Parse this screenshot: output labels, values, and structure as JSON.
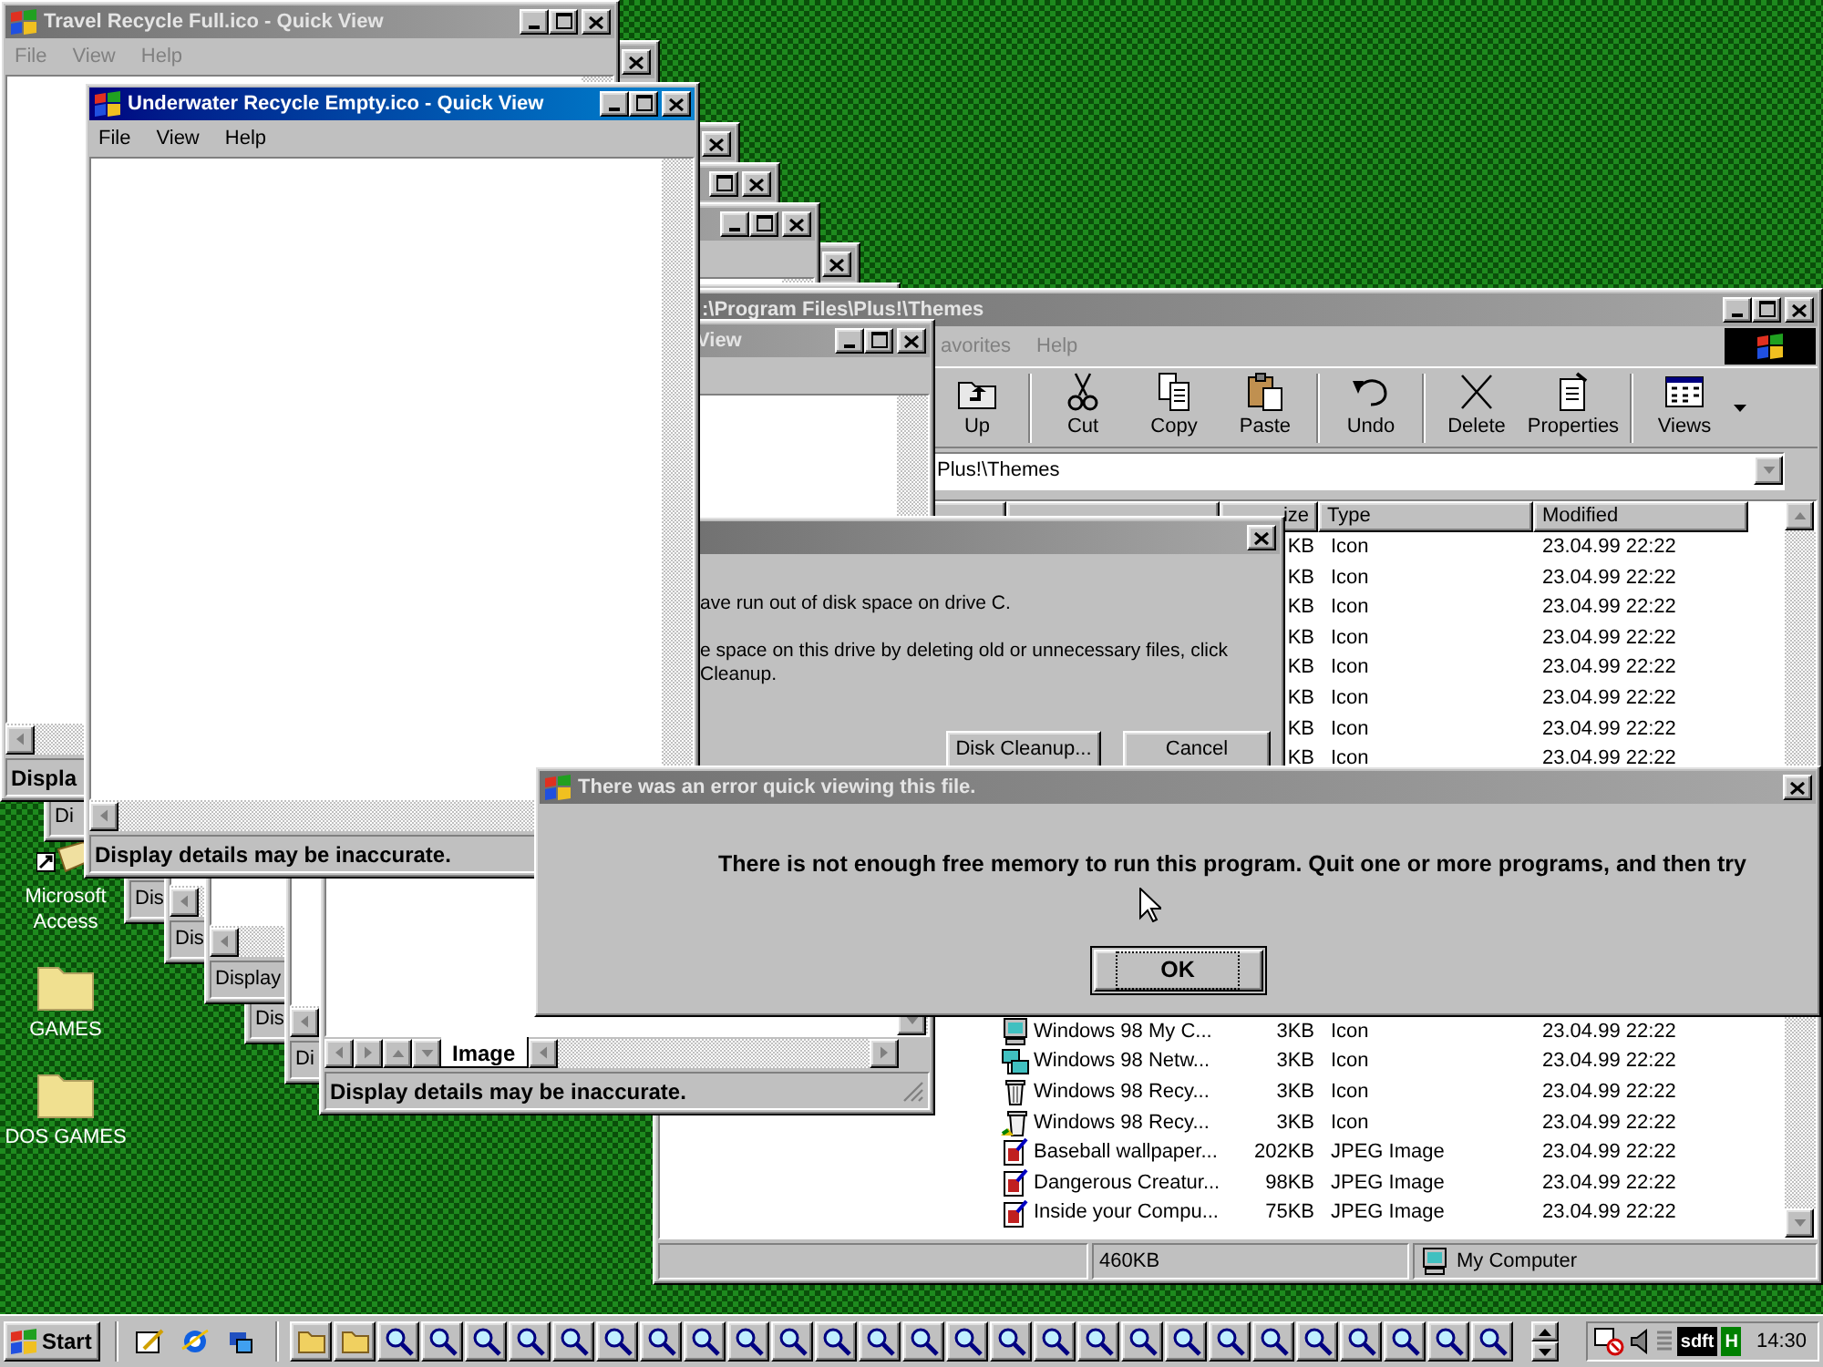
{
  "desktop_icons": [
    {
      "label": "Microsoft Access",
      "kind": "shortcut"
    },
    {
      "label": "GAMES",
      "kind": "folder"
    },
    {
      "label": "DOS GAMES",
      "kind": "folder"
    }
  ],
  "cascade_windows": [
    {
      "status": "Di"
    },
    {
      "status": "Dis"
    },
    {
      "status": "Dis"
    },
    {
      "status": "Display"
    },
    {
      "status": "Dis"
    },
    {
      "status": "Di"
    }
  ],
  "travel_window": {
    "title": "Travel Recycle Full.ico - Quick View",
    "active": false,
    "menu": [
      {
        "label": "File",
        "disabled": true
      },
      {
        "label": "View",
        "disabled": true
      },
      {
        "label": "Help",
        "disabled": true
      }
    ],
    "status": "Displa"
  },
  "explorer": {
    "title": ":\\Program Files\\Plus!\\Themes",
    "active": false,
    "menu": [
      {
        "label": "avorites",
        "disabled": true
      },
      {
        "label": "Help",
        "disabled": true
      }
    ],
    "toolbar": [
      {
        "label": "Up",
        "kind": "up"
      },
      {
        "label": "Cut",
        "kind": "cut"
      },
      {
        "label": "Copy",
        "kind": "copy"
      },
      {
        "label": "Paste",
        "kind": "paste"
      },
      {
        "label": "Undo",
        "kind": "undo"
      },
      {
        "label": "Delete",
        "kind": "delete"
      },
      {
        "label": "Properties",
        "kind": "properties"
      },
      {
        "label": "Views",
        "kind": "views"
      }
    ],
    "address": "Plus!\\Themes",
    "columns": [
      {
        "label": "ize"
      },
      {
        "label": "Type"
      },
      {
        "label": "Modified"
      }
    ],
    "rows_above": [
      {
        "size": "KB",
        "type": "Icon",
        "modified": "23.04.99 22:22"
      },
      {
        "size": "KB",
        "type": "Icon",
        "modified": "23.04.99 22:22"
      },
      {
        "size": "KB",
        "type": "Icon",
        "modified": "23.04.99 22:22"
      },
      {
        "size": "KB",
        "type": "Icon",
        "modified": "23.04.99 22:22"
      },
      {
        "size": "KB",
        "type": "Icon",
        "modified": "23.04.99 22:22"
      },
      {
        "size": "KB",
        "type": "Icon",
        "modified": "23.04.99 22:22"
      },
      {
        "size": "KB",
        "type": "Icon",
        "modified": "23.04.99 22:22"
      },
      {
        "size": "KB",
        "type": "Icon",
        "modified": "23.04.99 22:22"
      }
    ],
    "rows_below": [
      {
        "kind": "computer",
        "name": "Windows 98 My C...",
        "size": "3KB",
        "type": "Icon",
        "modified": "23.04.99 22:22"
      },
      {
        "kind": "network",
        "name": "Windows 98 Netw...",
        "size": "3KB",
        "type": "Icon",
        "modified": "23.04.99 22:22"
      },
      {
        "kind": "bin",
        "name": "Windows 98 Recy...",
        "size": "3KB",
        "type": "Icon",
        "modified": "23.04.99 22:22"
      },
      {
        "kind": "bin_full",
        "name": "Windows 98 Recy...",
        "size": "3KB",
        "type": "Icon",
        "modified": "23.04.99 22:22"
      },
      {
        "kind": "image",
        "name": "Baseball wallpaper...",
        "size": "202KB",
        "type": "JPEG Image",
        "modified": "23.04.99 22:22"
      },
      {
        "kind": "image",
        "name": "Dangerous Creatur...",
        "size": "98KB",
        "type": "JPEG Image",
        "modified": "23.04.99 22:22"
      },
      {
        "kind": "image",
        "name": "Inside your Compu...",
        "size": "75KB",
        "type": "JPEG Image",
        "modified": "23.04.99 22:22"
      }
    ],
    "status": [
      "460KB",
      "My Computer"
    ]
  },
  "image_window": {
    "title": "View",
    "active": false,
    "tab": "Image",
    "status": "Display details may be inaccurate."
  },
  "disk_dialog": {
    "active": false,
    "lines": [
      "ave run out of disk space on drive C.",
      "e space on this drive by deleting old or unnecessary files, click",
      "Cleanup."
    ],
    "buttons": [
      "Disk Cleanup...",
      "Cancel"
    ]
  },
  "underwater_window": {
    "title": "Underwater Recycle Empty.ico - Quick View",
    "active": true,
    "menu": [
      {
        "label": "File",
        "disabled": false
      },
      {
        "label": "View",
        "disabled": false
      },
      {
        "label": "Help",
        "disabled": false
      }
    ],
    "status": "Display details may be inaccurate."
  },
  "error_dialog": {
    "title": "There was an error quick viewing this file.",
    "active": false,
    "message": "There is not enough free memory to run this program. Quit one or more programs, and then try",
    "button": "OK"
  },
  "taskbar": {
    "start": "Start",
    "quick_launch": [
      {
        "kind": "desktop"
      },
      {
        "kind": "browser"
      },
      {
        "kind": "channels"
      }
    ],
    "tasks": [
      {
        "kind": "folder"
      },
      {
        "kind": "folder"
      },
      {
        "kind": "viewer"
      },
      {
        "kind": "viewer"
      },
      {
        "kind": "viewer"
      },
      {
        "kind": "viewer"
      },
      {
        "kind": "viewer"
      },
      {
        "kind": "viewer"
      },
      {
        "kind": "viewer"
      },
      {
        "kind": "viewer"
      },
      {
        "kind": "viewer"
      },
      {
        "kind": "viewer"
      },
      {
        "kind": "viewer"
      },
      {
        "kind": "viewer"
      },
      {
        "kind": "viewer"
      },
      {
        "kind": "viewer"
      },
      {
        "kind": "viewer"
      },
      {
        "kind": "viewer"
      },
      {
        "kind": "viewer"
      },
      {
        "kind": "viewer"
      },
      {
        "kind": "viewer"
      },
      {
        "kind": "viewer"
      },
      {
        "kind": "viewer"
      },
      {
        "kind": "viewer"
      },
      {
        "kind": "viewer"
      },
      {
        "kind": "viewer"
      },
      {
        "kind": "viewer"
      },
      {
        "kind": "viewer"
      }
    ],
    "tray": [
      {
        "kind": "scheduler"
      },
      {
        "kind": "volume"
      },
      {
        "kind": "meter"
      },
      {
        "kind": "badge",
        "text": "sdft",
        "color": "#000000"
      },
      {
        "kind": "badge",
        "text": "H",
        "color": "#008000"
      }
    ],
    "clock": "14:30"
  }
}
